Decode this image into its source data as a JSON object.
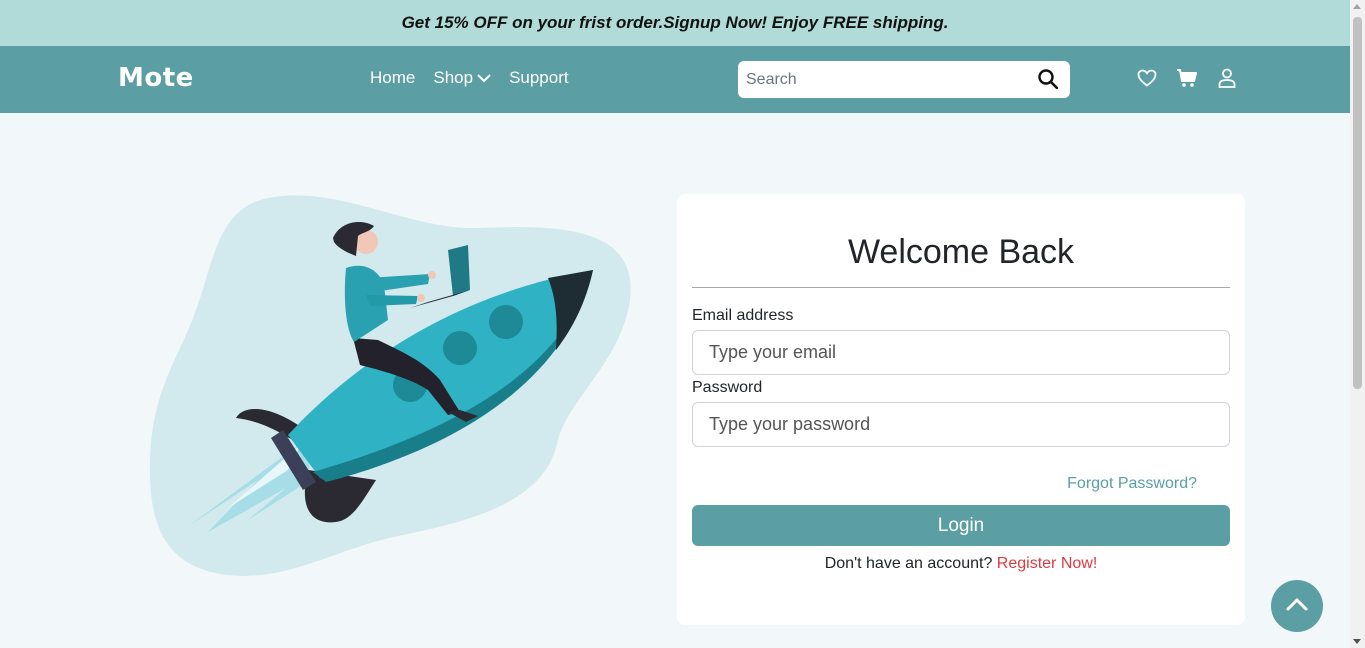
{
  "promo": {
    "text": "Get 15% OFF on your frist order.Signup Now! Enjoy FREE shipping."
  },
  "header": {
    "logo": "Mote",
    "nav": [
      {
        "label": "Home"
      },
      {
        "label": "Shop"
      },
      {
        "label": "Support"
      }
    ],
    "search": {
      "placeholder": "Search",
      "value": ""
    },
    "icons": [
      "heart-icon",
      "cart-icon",
      "user-icon"
    ]
  },
  "login": {
    "title": "Welcome Back",
    "email_label": "Email address",
    "email_placeholder": "Type your email",
    "password_label": "Password",
    "password_placeholder": "Type your password",
    "forgot_label": "Forgot Password?",
    "login_button": "Login",
    "no_account_text": "Don't have an account?",
    "register_link": "Register Now!"
  },
  "colors": {
    "promo_bg": "#b0dbd9",
    "nav_bg": "#5b9fa5",
    "page_bg": "#f2f8fa",
    "accent": "#5b9fa5",
    "register_link": "#e03a3e"
  }
}
